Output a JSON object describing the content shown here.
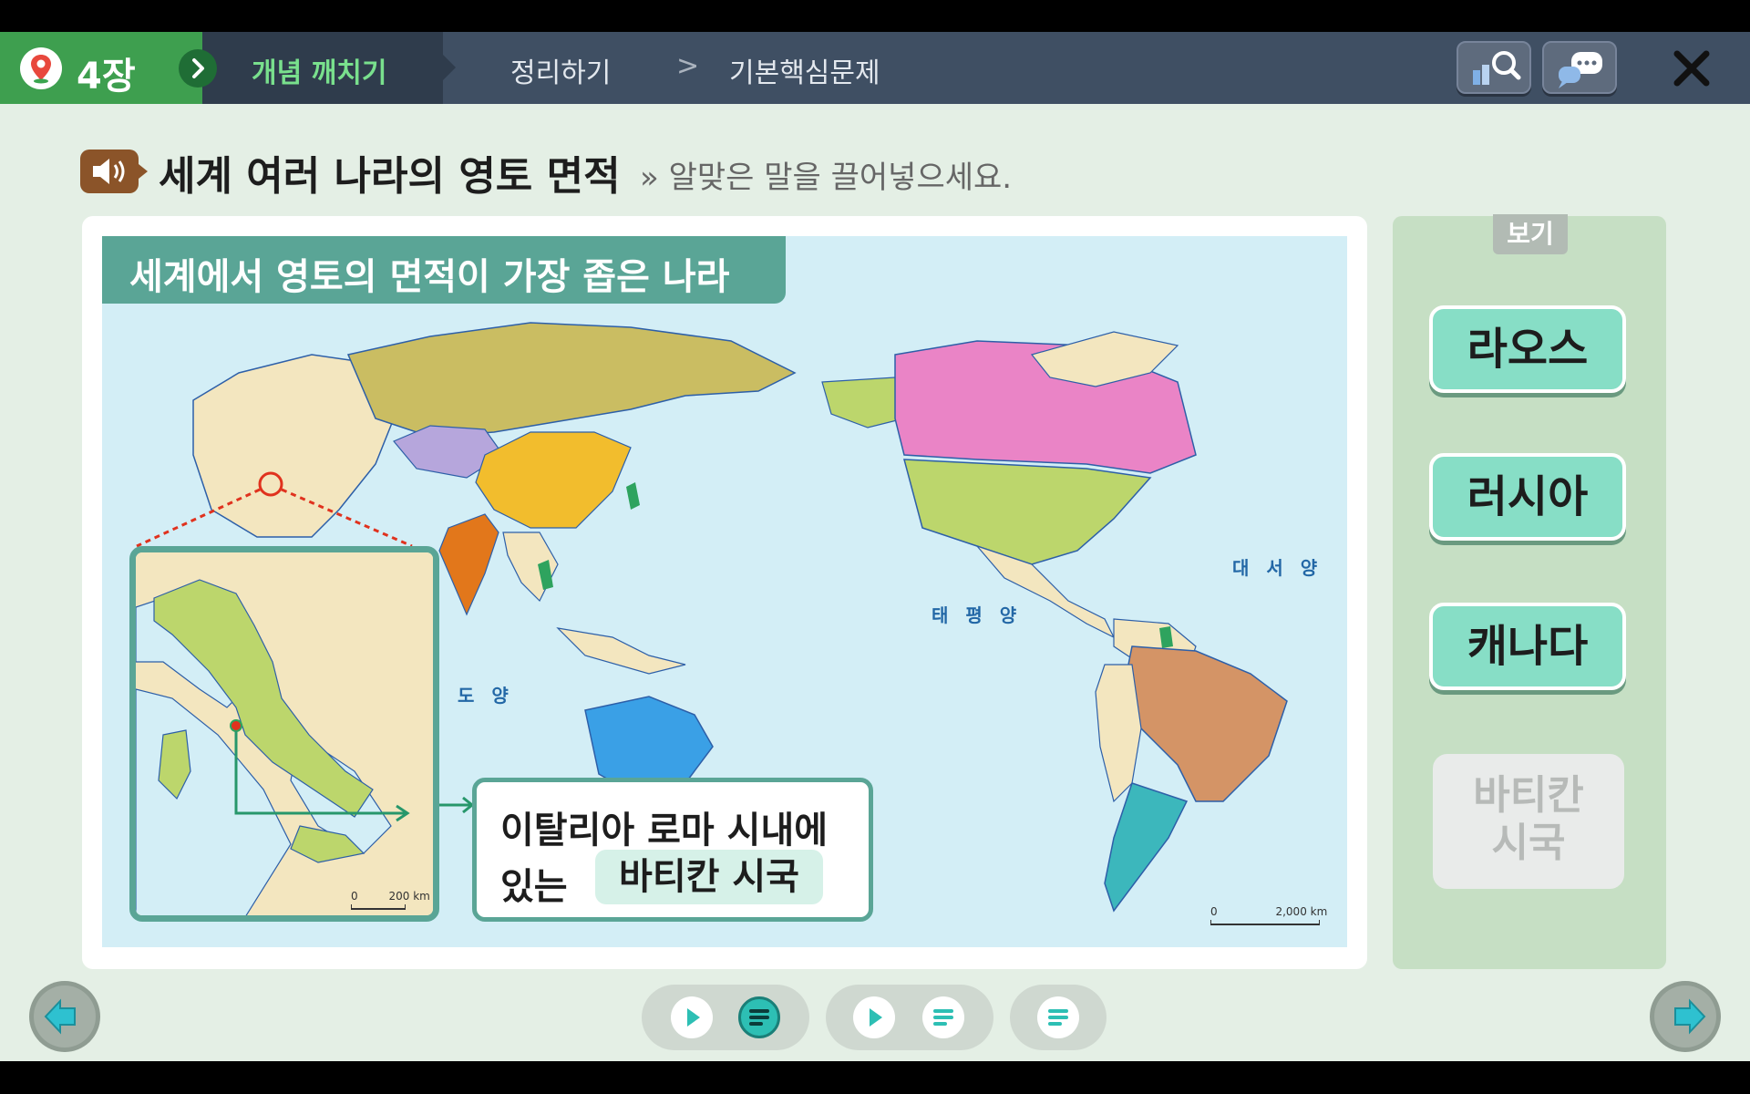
{
  "header": {
    "chapter": "4장",
    "tabs": [
      "개념 깨치기",
      "정리하기",
      "기본핵심문제"
    ],
    "separator": ">"
  },
  "title": {
    "text": "세계 여러 나라의 영토 면적",
    "instruction": "» 알맞은 말을 끌어넣으세요."
  },
  "map": {
    "heading": "세계에서 영토의 면적이 가장 좁은 나라",
    "ocean_labels": [
      "대 서 양",
      "태 평 양",
      "도 양"
    ],
    "inset_scale": {
      "zero": "0",
      "value": "200 km"
    },
    "map_scale": {
      "zero": "0",
      "value": "2,000 km"
    },
    "callout": {
      "line1": "이탈리아 로마 시내에",
      "line2_prefix": "있는",
      "answer": "바티칸 시국"
    }
  },
  "side": {
    "header": "보기",
    "options": [
      "라오스",
      "러시아",
      "캐나다"
    ],
    "used_option": "바티칸\n시국"
  },
  "icons": {
    "sound": "speaker-icon",
    "search": "search-icon",
    "chat": "chat-icon",
    "close": "close-icon"
  },
  "colors": {
    "accent_green": "#3e9f4f",
    "teal": "#5aa596",
    "option_mint": "#87dec6",
    "topbar": "#3f4f63"
  }
}
